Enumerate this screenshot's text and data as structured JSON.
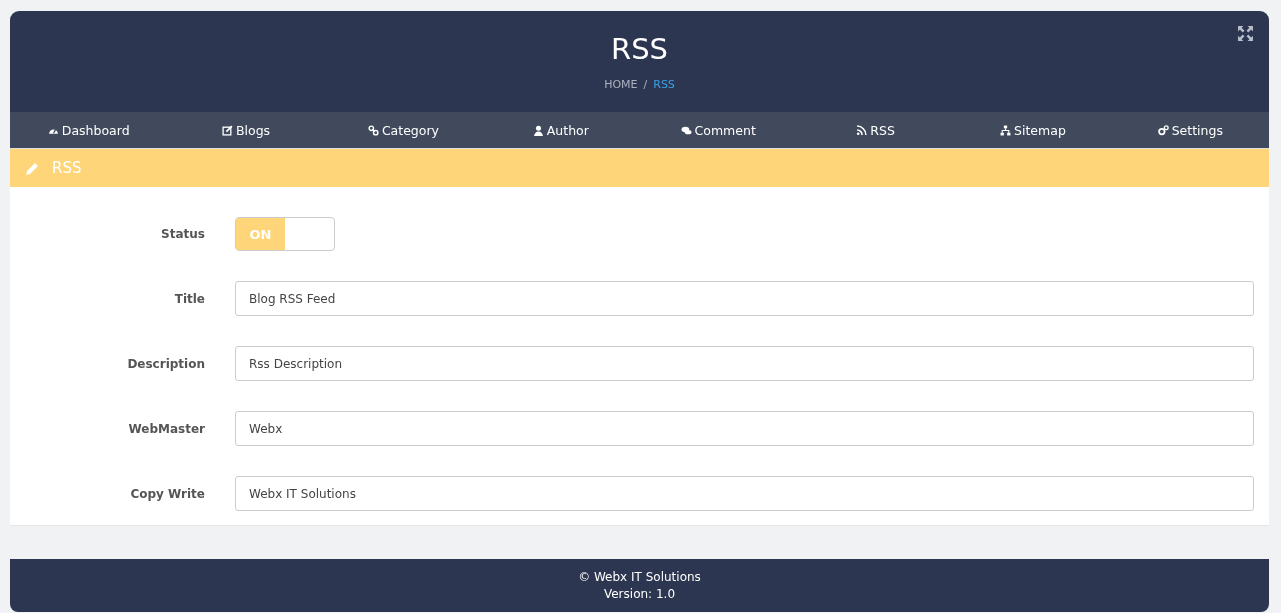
{
  "header": {
    "title": "RSS",
    "separator": "/",
    "breadcrumb": [
      {
        "label": "HOME",
        "current": false
      },
      {
        "label": "RSS",
        "current": true
      }
    ]
  },
  "nav": [
    {
      "label": "Dashboard"
    },
    {
      "label": "Blogs"
    },
    {
      "label": "Category"
    },
    {
      "label": "Author"
    },
    {
      "label": "Comment"
    },
    {
      "label": "RSS"
    },
    {
      "label": "Sitemap"
    },
    {
      "label": "Settings"
    }
  ],
  "panel": {
    "title": "RSS"
  },
  "status": {
    "label": "Status",
    "on": true,
    "text": "ON"
  },
  "fields": [
    {
      "label": "Title",
      "value": "Blog RSS Feed"
    },
    {
      "label": "Description",
      "value": "Rss Description"
    },
    {
      "label": "WebMaster",
      "value": "Webx"
    },
    {
      "label": "Copy Write",
      "value": "Webx IT Solutions"
    }
  ],
  "footer": {
    "copyright": "© Webx IT Solutions",
    "version": "Version: 1.0"
  }
}
